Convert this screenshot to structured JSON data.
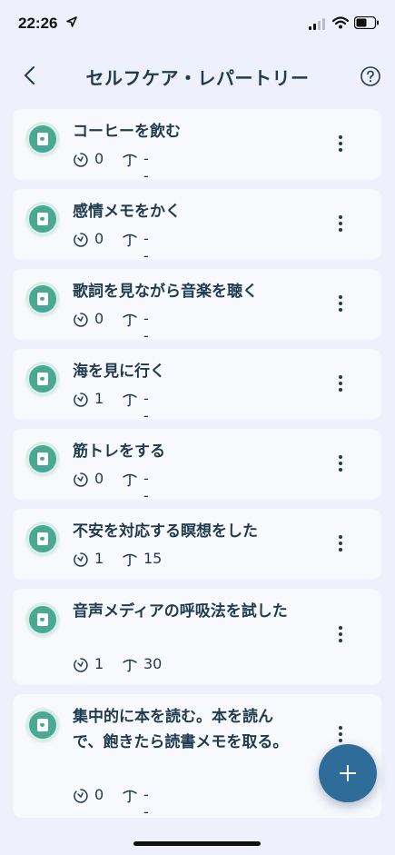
{
  "status_bar": {
    "time": "22:26"
  },
  "header": {
    "title": "セルフケア・レパートリー"
  },
  "items": [
    {
      "title": "コーヒーを飲む",
      "count": "0",
      "value": "--"
    },
    {
      "title": "感情メモをかく",
      "count": "0",
      "value": "--"
    },
    {
      "title": "歌詞を見ながら音楽を聴く",
      "count": "0",
      "value": "--"
    },
    {
      "title": "海を見に行く",
      "count": "1",
      "value": "--"
    },
    {
      "title": "筋トレをする",
      "count": "0",
      "value": "--"
    },
    {
      "title": "不安を対応する瞑想をした",
      "count": "1",
      "value": "15"
    },
    {
      "title": "音声メディアの呼吸法を試した",
      "count": "1",
      "value": "30"
    },
    {
      "title": "集中的に本を読む。本を読んで、飽きたら読書メモを取る。",
      "count": "0",
      "value": "--"
    }
  ],
  "colors": {
    "accent": "#4aa893",
    "fab": "#2e6c99",
    "text": "#1f3b4d",
    "background": "#eef0fb"
  },
  "icons": {
    "back": "chevron-left-icon",
    "help": "question-circle-icon",
    "item": "note-heart-icon",
    "count": "clock-check-icon",
    "value": "thermometer-icon",
    "add": "plus-icon"
  }
}
